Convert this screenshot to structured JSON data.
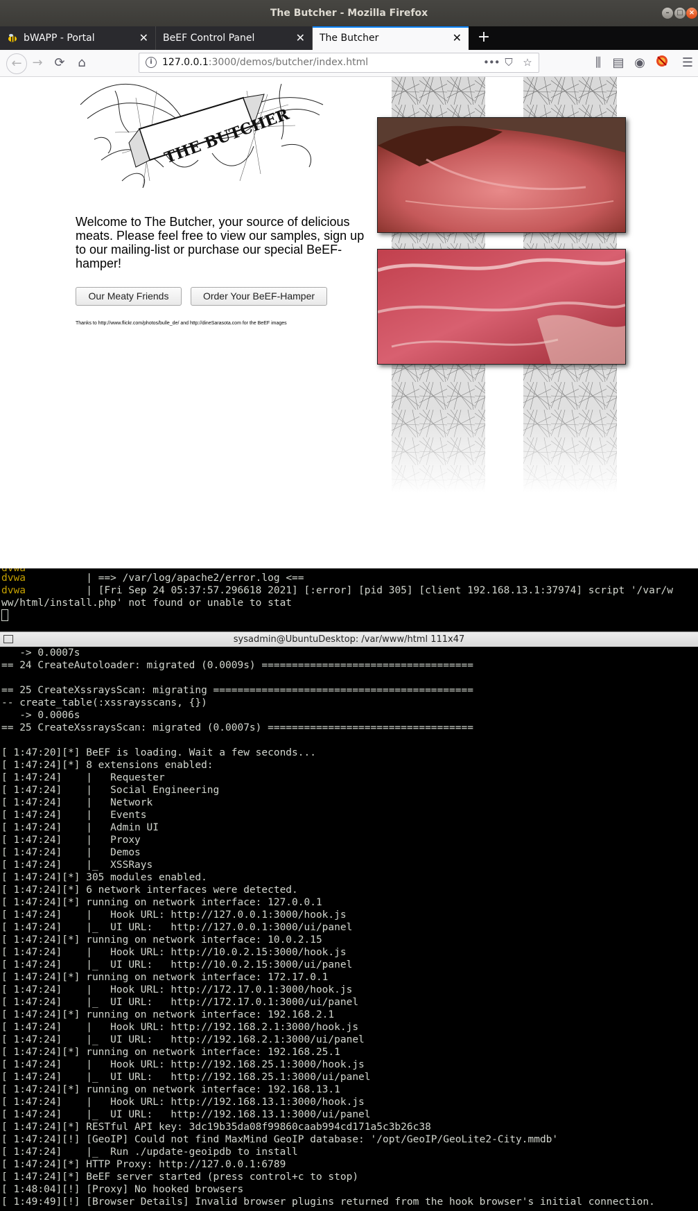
{
  "window": {
    "title": "The Butcher - Mozilla Firefox"
  },
  "tabs": [
    {
      "label": "bWAPP - Portal",
      "active": false
    },
    {
      "label": "BeEF Control Panel",
      "active": false
    },
    {
      "label": "The Butcher",
      "active": true
    }
  ],
  "navbar": {
    "url_host": "127.0.0.1",
    "url_rest": ":3000/demos/butcher/index.html",
    "more_label": "•••"
  },
  "page": {
    "logo_text": "THE BUTCHER",
    "welcome": "Welcome to The Butcher, your source of delicious meats. Please feel free to view our samples, sign up to our mailing-list or purchase our special BeEF-hamper!",
    "button_friends": "Our Meaty Friends",
    "button_order": "Order Your BeEF-Hamper",
    "thanks": "Thanks to http://www.flickr.com/photos/bulle_de/ and http://dineSarasota.com for the BeEF images"
  },
  "terminal1": {
    "lines": [
      {
        "prefix": "dvwa",
        "text": "| ==> /var/log/apache2/error.log <=="
      },
      {
        "prefix": "dvwa",
        "text": "| [Fri Sep 24 05:37:57.296618 2021] [:error] [pid 305] [client 192.168.13.1:37974] script '/var/w"
      },
      {
        "prefix": "",
        "text": "ww/html/install.php' not found or unable to stat"
      }
    ]
  },
  "terminal2": {
    "title": "sysadmin@UbuntuDesktop: /var/www/html 111x47",
    "lines": [
      "   -> 0.0007s",
      "== 24 CreateAutoloader: migrated (0.0009s) ===================================",
      "",
      "== 25 CreateXssraysScan: migrating ===========================================",
      "-- create_table(:xssraysscans, {})",
      "   -> 0.0006s",
      "== 25 CreateXssraysScan: migrated (0.0007s) ==================================",
      "",
      "[ 1:47:20][*] BeEF is loading. Wait a few seconds...",
      "[ 1:47:24][*] 8 extensions enabled:",
      "[ 1:47:24]    |   Requester",
      "[ 1:47:24]    |   Social Engineering",
      "[ 1:47:24]    |   Network",
      "[ 1:47:24]    |   Events",
      "[ 1:47:24]    |   Admin UI",
      "[ 1:47:24]    |   Proxy",
      "[ 1:47:24]    |   Demos",
      "[ 1:47:24]    |_  XSSRays",
      "[ 1:47:24][*] 305 modules enabled.",
      "[ 1:47:24][*] 6 network interfaces were detected.",
      "[ 1:47:24][*] running on network interface: 127.0.0.1",
      "[ 1:47:24]    |   Hook URL: http://127.0.0.1:3000/hook.js",
      "[ 1:47:24]    |_  UI URL:   http://127.0.0.1:3000/ui/panel",
      "[ 1:47:24][*] running on network interface: 10.0.2.15",
      "[ 1:47:24]    |   Hook URL: http://10.0.2.15:3000/hook.js",
      "[ 1:47:24]    |_  UI URL:   http://10.0.2.15:3000/ui/panel",
      "[ 1:47:24][*] running on network interface: 172.17.0.1",
      "[ 1:47:24]    |   Hook URL: http://172.17.0.1:3000/hook.js",
      "[ 1:47:24]    |_  UI URL:   http://172.17.0.1:3000/ui/panel",
      "[ 1:47:24][*] running on network interface: 192.168.2.1",
      "[ 1:47:24]    |   Hook URL: http://192.168.2.1:3000/hook.js",
      "[ 1:47:24]    |_  UI URL:   http://192.168.2.1:3000/ui/panel",
      "[ 1:47:24][*] running on network interface: 192.168.25.1",
      "[ 1:47:24]    |   Hook URL: http://192.168.25.1:3000/hook.js",
      "[ 1:47:24]    |_  UI URL:   http://192.168.25.1:3000/ui/panel",
      "[ 1:47:24][*] running on network interface: 192.168.13.1",
      "[ 1:47:24]    |   Hook URL: http://192.168.13.1:3000/hook.js",
      "[ 1:47:24]    |_  UI URL:   http://192.168.13.1:3000/ui/panel",
      "[ 1:47:24][*] RESTful API key: 3dc19b35da08f99860caab994cd171a5c3b26c38",
      "[ 1:47:24][!] [GeoIP] Could not find MaxMind GeoIP database: '/opt/GeoIP/GeoLite2-City.mmdb'",
      "[ 1:47:24]    |_  Run ./update-geoipdb to install",
      "[ 1:47:24][*] HTTP Proxy: http://127.0.0.1:6789",
      "[ 1:47:24][*] BeEF server started (press control+c to stop)",
      "[ 1:48:04][!] [Proxy] No hooked browsers",
      "[ 1:49:49][!] [Browser Details] Invalid browser plugins returned from the hook browser's initial connection."
    ]
  },
  "colors": {
    "tab_accent": "#0a84ff",
    "terminal_fg": "#d3d7cf",
    "terminal_prefix": "#c4a000"
  }
}
